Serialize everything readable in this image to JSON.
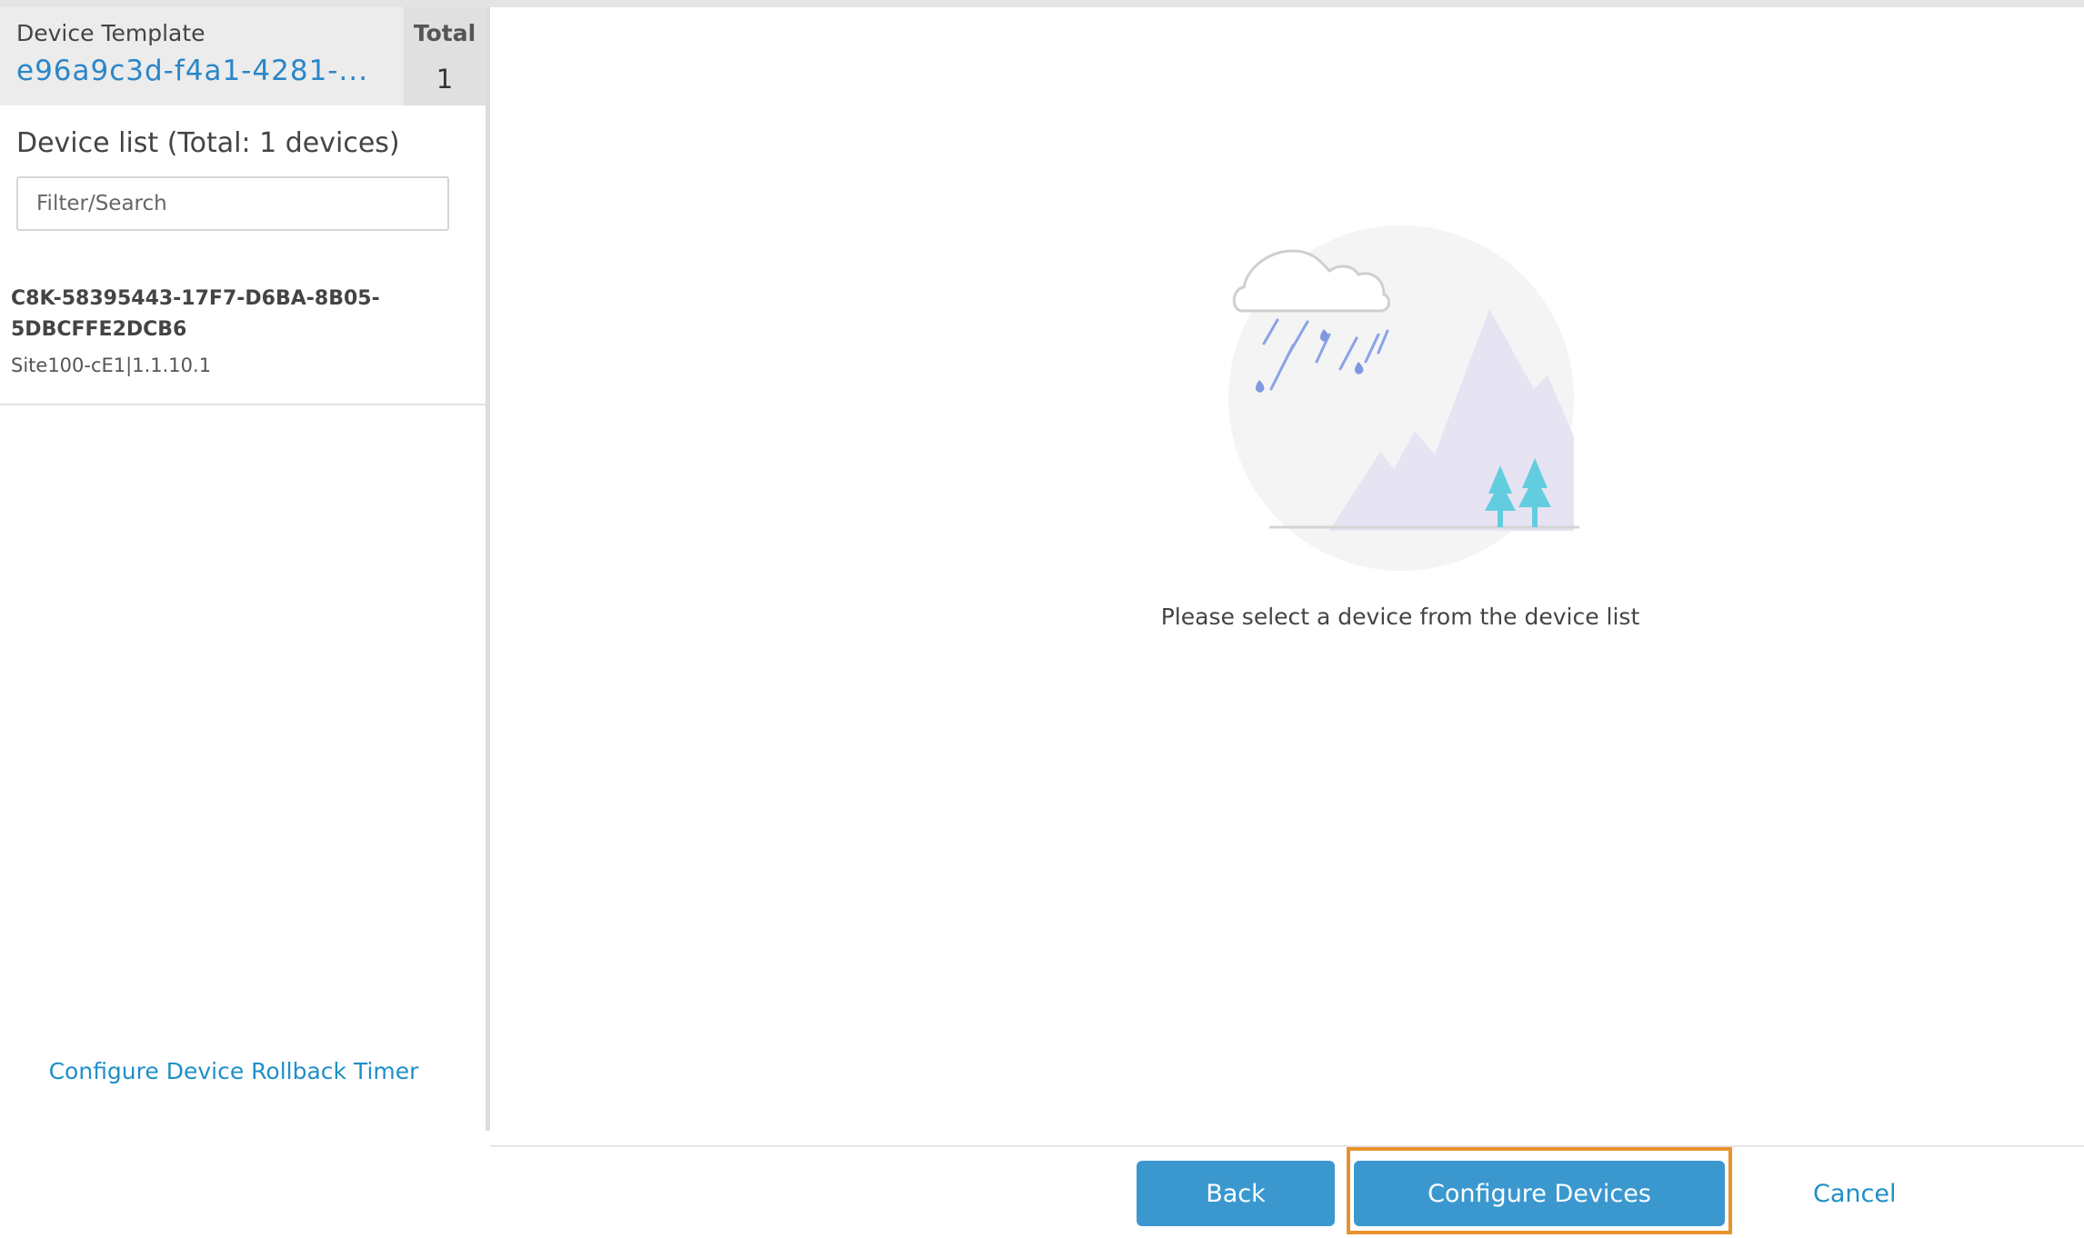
{
  "template_panel": {
    "label": "Device Template",
    "name": "e96a9c3d-f4a1-4281-...",
    "total_label": "Total",
    "total_value": "1"
  },
  "device_list": {
    "title": "Device list (Total: 1 devices)",
    "search_placeholder": "Filter/Search",
    "items": [
      {
        "id": "C8K-58395443-17F7-D6BA-8B05-5DBCFFE2DCB6",
        "site": "Site100-cE1|1.1.10.1"
      }
    ]
  },
  "rollback_link": "Configure Device Rollback Timer",
  "empty_state": {
    "illustration": "rain-mountain-illustration",
    "message": "Please select a device from the device list"
  },
  "footer": {
    "back_label": "Back",
    "configure_label": "Configure Devices",
    "cancel_label": "Cancel",
    "highlight_color": "#e8922e"
  },
  "colors": {
    "accent": "#3b98cf",
    "link": "#1f8fc7"
  }
}
